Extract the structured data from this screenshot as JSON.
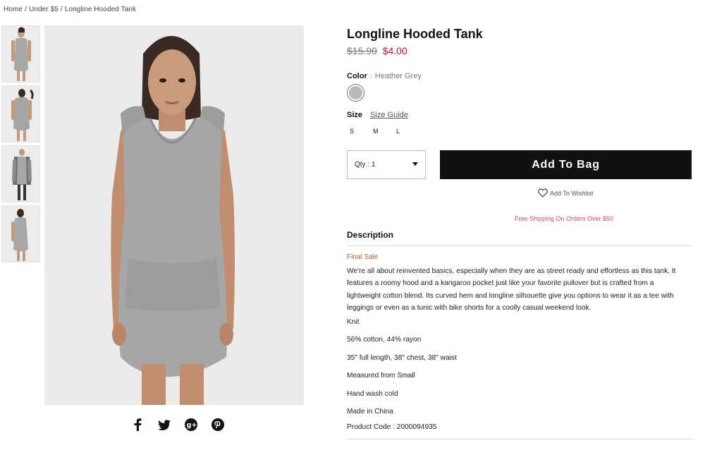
{
  "breadcrumb": [
    "Home",
    "Under $5",
    "Longline Hooded Tank"
  ],
  "product": {
    "title": "Longline Hooded Tank",
    "old_price": "$15.90",
    "new_price": "$4.00"
  },
  "color": {
    "label": "Color",
    "separator": ":",
    "value": "Heather Grey",
    "swatch_hex": "#b9b9b9"
  },
  "size": {
    "label": "Size",
    "guide_link": "Size Guide",
    "options": [
      "S",
      "M",
      "L"
    ]
  },
  "qty": {
    "label": "Qty : 1"
  },
  "add_to_bag": "Add To Bag",
  "wishlist": "Add To Wishlist",
  "shipping_note": "Free Shipping On Orders Over $50",
  "description": {
    "title": "Description",
    "sale_tag": "Final Sale",
    "body": "We're all about reinvented basics, especially when they are as street ready and effortless as this tank. It features a roomy hood and a kangaroo pocket just like your favorite pullover but is crafted from a lightweight cotton blend. Its curved hem and longline silhouette give you options to wear it as a tee with leggings or even as a tunic with bike shorts for a coolly casual weekend look.",
    "details": [
      "Knit",
      "56% cotton, 44% rayon",
      "35\" full length, 38\" chest, 38\" waist",
      "Measured from Small",
      "Hand wash cold",
      "Made in China",
      "Product Code : 2000094935"
    ]
  },
  "social": [
    "facebook-icon",
    "twitter-icon",
    "google-plus-icon",
    "pinterest-icon"
  ],
  "colors": {
    "price_red": "#c8102e",
    "shipping_pink": "#c64a7a",
    "sale_brown": "#b05a37",
    "button_black": "#111111"
  }
}
